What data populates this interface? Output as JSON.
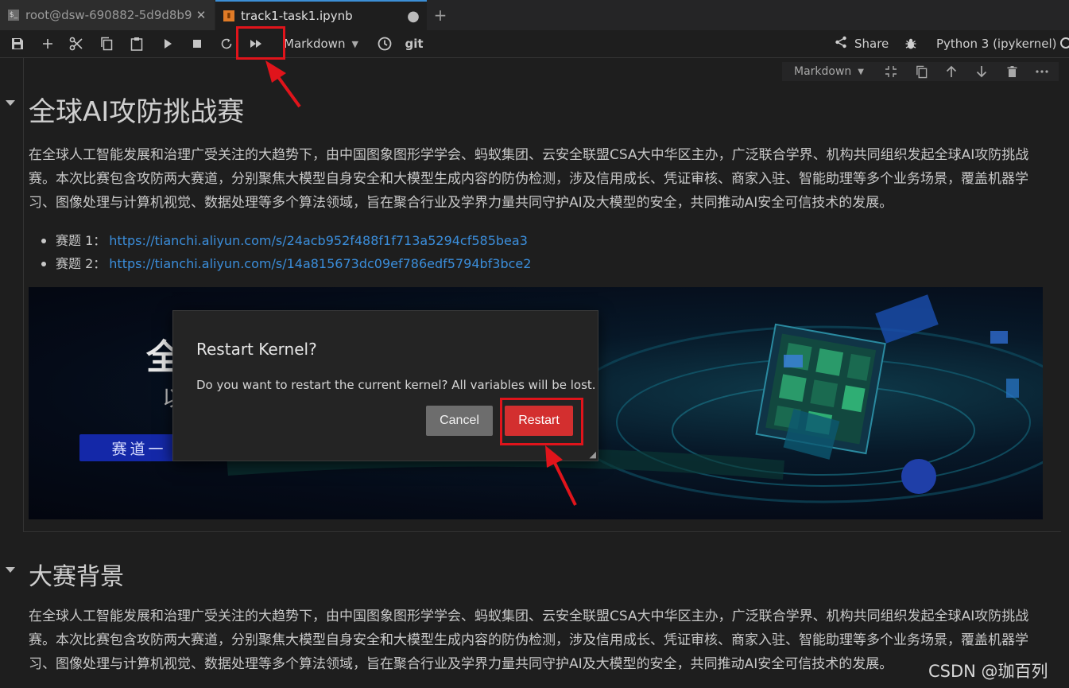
{
  "tabs": [
    {
      "label": "root@dsw-690882-5d9d8b9!",
      "icon": "terminal-icon",
      "close": "✕"
    },
    {
      "label": "track1-task1.ipynb",
      "icon": "notebook-icon",
      "close": "●"
    }
  ],
  "new_tab_label": "+",
  "toolbar": {
    "cell_type": "Markdown",
    "git_label": "git",
    "share_label": "Share",
    "kernel_name": "Python 3 (ipykernel)"
  },
  "cell_toolbar": {
    "cell_type": "Markdown"
  },
  "cells": [
    {
      "heading": "全球AI攻防挑战赛",
      "paragraph": "在全球人工智能发展和治理广受关注的大趋势下，由中国图象图形学学会、蚂蚁集团、云安全联盟CSA大中华区主办，广泛联合学界、机构共同组织发起全球AI攻防挑战赛。本次比赛包含攻防两大赛道，分别聚焦大模型自身安全和大模型生成内容的防伪检测，涉及信用成长、凭证审核、商家入驻、智能助理等多个业务场景，覆盖机器学习、图像处理与计算机视觉、数据处理等多个算法领域，旨在聚合行业及学界力量共同守护AI及大模型的安全，共同推动AI安全可信技术的发展。",
      "bullets": [
        {
          "label": "赛题 1：",
          "link": "https://tianchi.aliyun.com/s/24acb952f488f1f713a5294cf585bea3"
        },
        {
          "label": "赛题 2：",
          "link": "https://tianchi.aliyun.com/s/14a815673dc09ef786edf5794bf3bce2"
        }
      ],
      "banner": {
        "title_fragment": "全",
        "subtitle_fragment": "以",
        "track_button": "赛道一"
      }
    },
    {
      "heading": "大赛背景",
      "paragraph": "在全球人工智能发展和治理广受关注的大趋势下，由中国图象图形学学会、蚂蚁集团、云安全联盟CSA大中华区主办，广泛联合学界、机构共同组织发起全球AI攻防挑战赛。本次比赛包含攻防两大赛道，分别聚焦大模型自身安全和大模型生成内容的防伪检测，涉及信用成长、凭证审核、商家入驻、智能助理等多个业务场景，覆盖机器学习、图像处理与计算机视觉、数据处理等多个算法领域，旨在聚合行业及学界力量共同守护AI及大模型的安全，共同推动AI安全可信技术的发展。"
    }
  ],
  "dialog": {
    "title": "Restart Kernel?",
    "message": "Do you want to restart the current kernel? All variables will be lost.",
    "cancel_label": "Cancel",
    "restart_label": "Restart"
  },
  "watermark": "CSDN @珈百列",
  "colors": {
    "background": "#1e1e1e",
    "accent_tab": "#3c8fd6",
    "link": "#3b8edb",
    "restart_button": "#d32f2f",
    "annotation": "#e0141b"
  }
}
